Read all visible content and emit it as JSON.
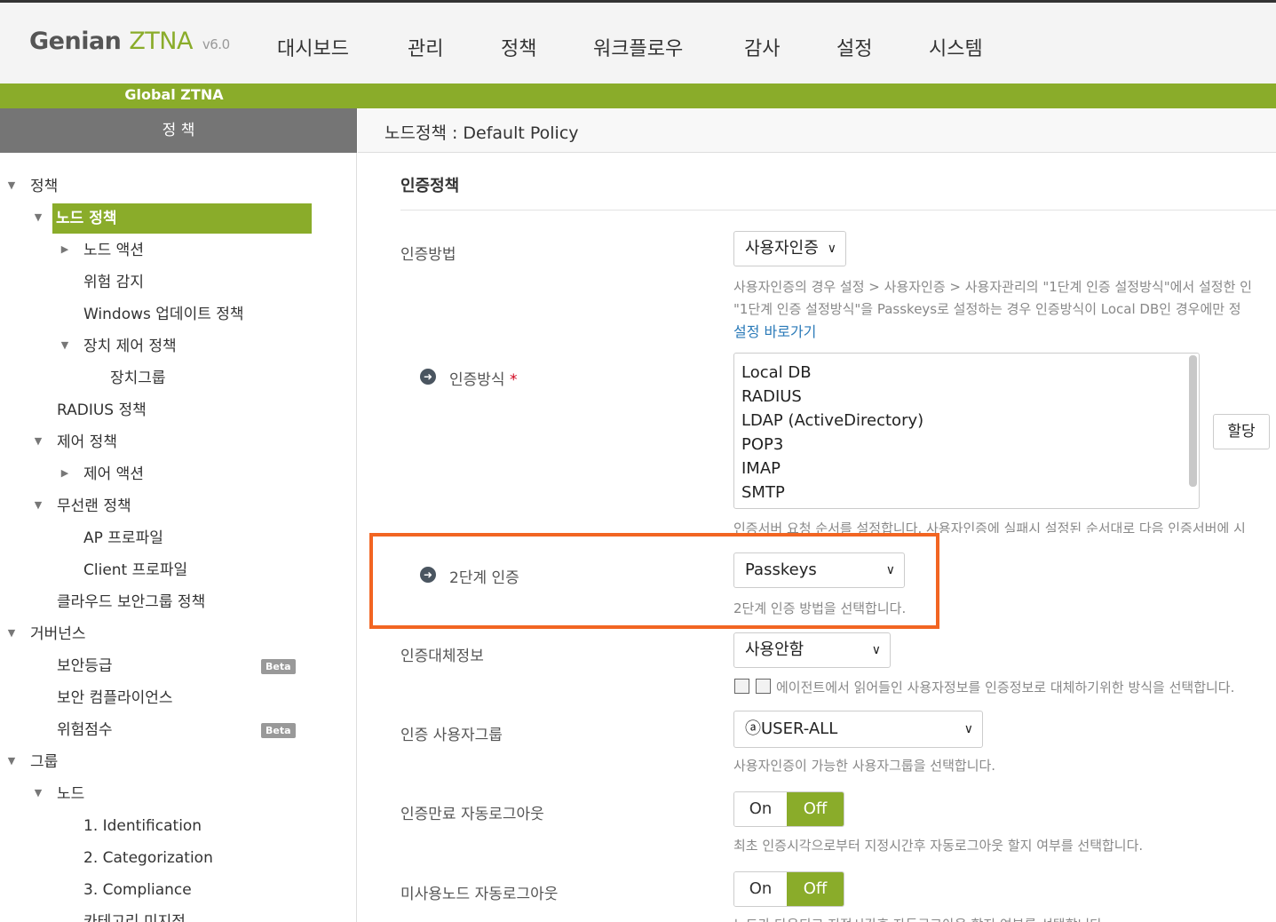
{
  "header": {
    "logo_genian": "Genian",
    "logo_ztna": "ZTNA",
    "logo_version": "v6.0",
    "menu": [
      "대시보드",
      "관리",
      "정책",
      "워크플로우",
      "감사",
      "설정",
      "시스템"
    ],
    "site": "Global ZTNA"
  },
  "sidebar": {
    "title": "정 책",
    "items": [
      "정책",
      "노드 정책",
      "노드 액션",
      "위험 감지",
      "Windows 업데이트 정책",
      "장치 제어 정책",
      "장치그룹",
      "RADIUS 정책",
      "제어 정책",
      "제어 액션",
      "무선랜 정책",
      "AP 프로파일",
      "Client 프로파일",
      "클라우드 보안그룹 정책",
      "거버넌스",
      "보안등급",
      "보안 컴플라이언스",
      "위험점수",
      "그룹",
      "노드",
      "1. Identification",
      "2. Categorization",
      "3. Compliance",
      "카테고리 미지정"
    ],
    "beta": "Beta"
  },
  "content": {
    "title": "노드정책 : Default Policy",
    "section": "인증정책",
    "auth_method_label": "인증방법",
    "auth_method_value": "사용자인증",
    "auth_method_help1": "사용자인증의 경우 설정 > 사용자인증 > 사용자관리의 \"1단계 인증 설정방식\"에서 설정한 인",
    "auth_method_help2": "\"1단계 인증 설정방식\"을 Passkeys로 설정하는 경우 인증방식이 Local DB인 경우에만 정",
    "settings_link": "설정 바로가기",
    "auth_type_label": "인증방식",
    "required_mark": "*",
    "auth_type_options": [
      "Local DB",
      "RADIUS",
      "LDAP (ActiveDirectory)",
      "POP3",
      "IMAP",
      "SMTP"
    ],
    "assign_button": "할당",
    "auth_type_help": "인증서버 요청 순서를 설정합니다. 사용자인증에 실패시 설정된 순서대로 다음 인증서버에 시",
    "mfa_label": "2단계 인증",
    "mfa_value": "Passkeys",
    "mfa_help": "2단계 인증 방법을 선택합니다.",
    "alt_info_label": "인증대체정보",
    "alt_info_value": "사용안함",
    "alt_info_help": "에이전트에서 읽어들인 사용자정보를 인증정보로 대체하기위한 방식을 선택합니다.",
    "user_group_label": "인증 사용자그룹",
    "user_group_value": "ⓐUSER-ALL",
    "user_group_help": "사용자인증이 가능한 사용자그룹을 선택합니다.",
    "expire_logout_label": "인증만료 자동로그아웃",
    "expire_logout_help": "최초 인증시각으로부터 지정시간후 자동로그아웃 할지 여부를 선택합니다.",
    "unused_logout_label": "미사용노드 자동로그아웃",
    "unused_logout_help": "노드가 다운되고 지정시간후 자동로그아웃 할지 여부를 선택합니다.",
    "toggle_on": "On",
    "toggle_off": "Off"
  }
}
